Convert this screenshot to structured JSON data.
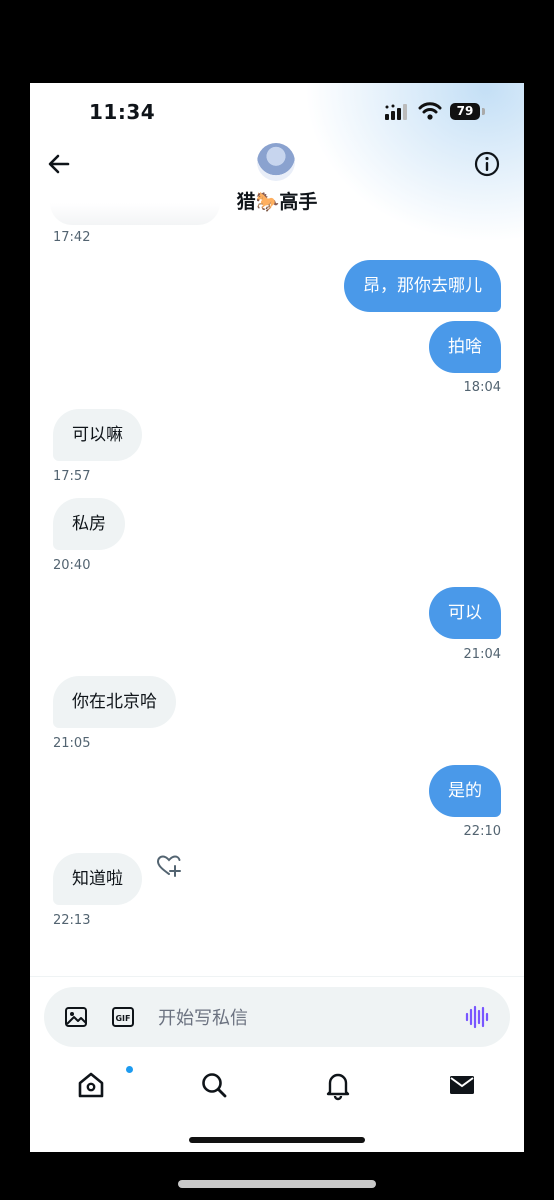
{
  "status_bar": {
    "time": "11:34",
    "battery": "79"
  },
  "header": {
    "contact_name": "猎🐎高手"
  },
  "messages": [
    {
      "text": "昂，那你去哪儿",
      "direction": "out"
    },
    {
      "text": "拍啥",
      "direction": "out",
      "time": "18:04"
    },
    {
      "text": "可以嘛",
      "direction": "in",
      "time": "17:57"
    },
    {
      "text": "私房",
      "direction": "in",
      "time": "20:40"
    },
    {
      "text": "可以",
      "direction": "out",
      "time": "21:04"
    },
    {
      "text": "你在北京哈",
      "direction": "in",
      "time": "21:05"
    },
    {
      "text": "是的",
      "direction": "out",
      "time": "22:10"
    },
    {
      "text": "知道啦",
      "direction": "in",
      "time": "22:13"
    }
  ],
  "earlier_message_time": "17:42",
  "composer": {
    "placeholder": "开始写私信"
  },
  "tabs": [
    "home-icon",
    "search-icon",
    "notifications-icon",
    "messages-icon"
  ],
  "colors": {
    "outgoing_bubble": "#4a99e9",
    "incoming_bubble": "#eff3f4",
    "voice_accent": "#7856ff"
  }
}
